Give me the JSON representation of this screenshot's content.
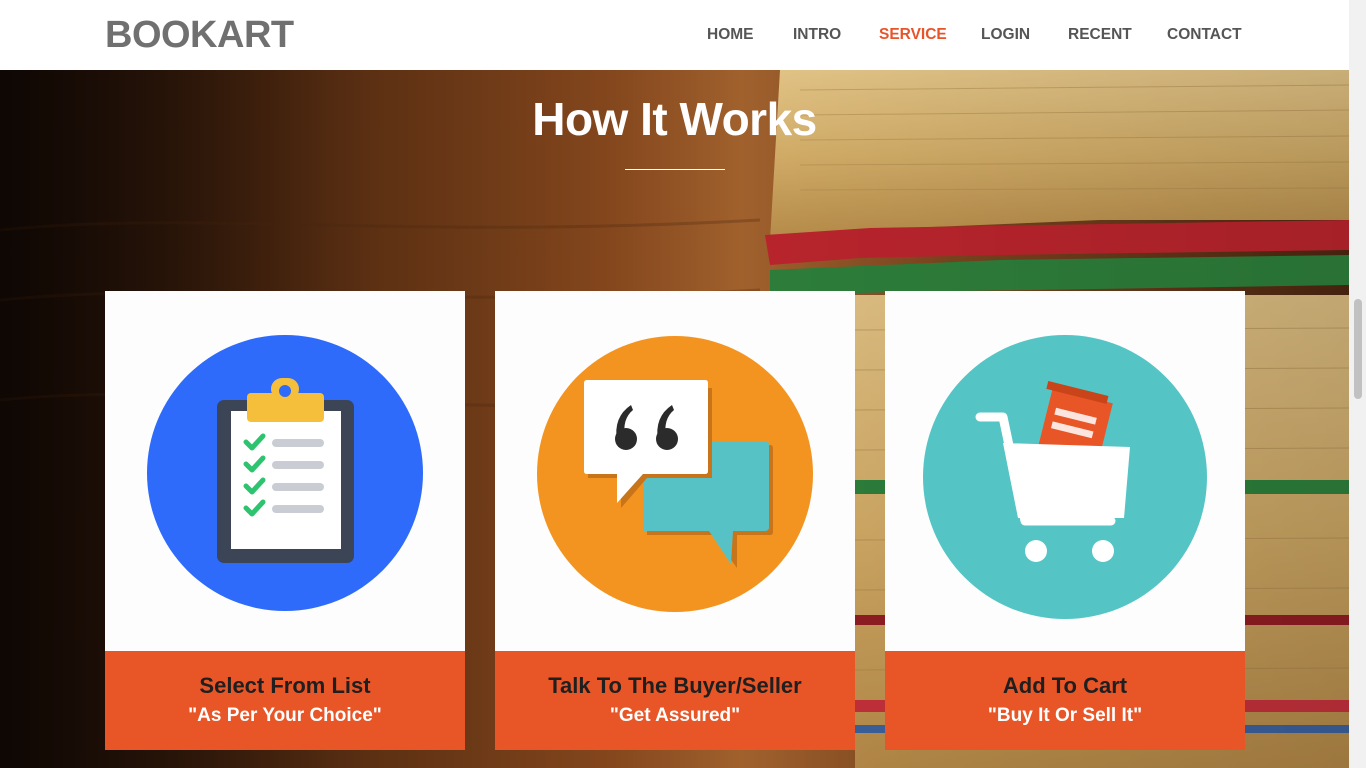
{
  "brand": {
    "name": "BOOKART"
  },
  "nav": {
    "items": [
      {
        "label": "HOME"
      },
      {
        "label": "INTRO"
      },
      {
        "label": "SERVICE"
      },
      {
        "label": "LOGIN"
      },
      {
        "label": "RECENT"
      },
      {
        "label": "CONTACT"
      }
    ],
    "active": "SERVICE"
  },
  "section": {
    "title": "How It Works"
  },
  "cards": [
    {
      "title": "Select From List",
      "subtitle": "\"As Per Your Choice\"",
      "icon": "clipboard-checklist-icon"
    },
    {
      "title": "Talk To The Buyer/Seller",
      "subtitle": "\"Get Assured\"",
      "icon": "speech-bubbles-icon"
    },
    {
      "title": "Add To Cart",
      "subtitle": "\"Buy It Or Sell It\"",
      "icon": "shopping-cart-icon"
    }
  ],
  "colors": {
    "accent": "#e8542a",
    "caption": "#e85526",
    "icon_blue": "#2e6bfa",
    "icon_orange": "#f39421",
    "icon_teal": "#55c4c5"
  }
}
